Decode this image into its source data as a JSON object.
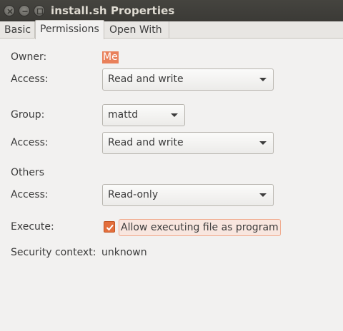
{
  "window": {
    "title": "install.sh Properties"
  },
  "tabs": [
    {
      "label": "Basic"
    },
    {
      "label": "Permissions"
    },
    {
      "label": "Open With"
    }
  ],
  "permissions": {
    "owner_label": "Owner:",
    "owner_value": "Me",
    "owner_access_label": "Access:",
    "owner_access_value": "Read and write",
    "group_label": "Group:",
    "group_value": "mattd",
    "group_access_label": "Access:",
    "group_access_value": "Read and write",
    "others_label": "Others",
    "others_access_label": "Access:",
    "others_access_value": "Read-only",
    "execute_label": "Execute:",
    "execute_checkbox_label": "Allow executing file as program",
    "execute_checked": true,
    "security_label": "Security context:",
    "security_value": "unknown"
  },
  "colors": {
    "accent": "#e9805a",
    "titlebar": "#3c3b37",
    "background": "#f2f1f0"
  },
  "icons": [
    "close-icon",
    "minimize-icon",
    "maximize-icon",
    "chevron-down-icon",
    "checkmark-icon"
  ]
}
